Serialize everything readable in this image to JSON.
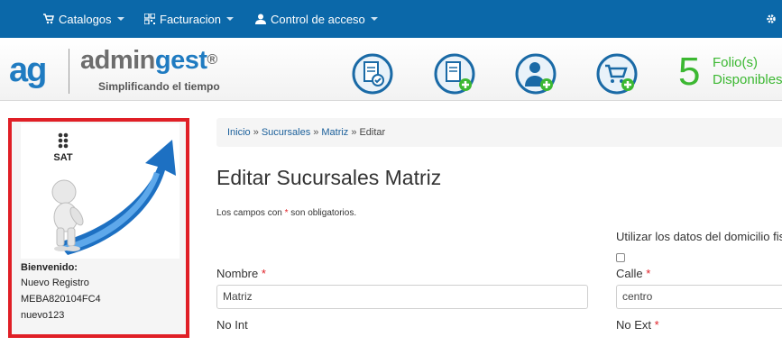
{
  "topnav": {
    "catalogos": "Catalogos",
    "facturacion": "Facturacion",
    "control_acceso": "Control de acceso"
  },
  "brand": {
    "mark": "ag",
    "name_a": "admin",
    "name_b": "gest",
    "registered": "®",
    "tagline": "Simplificando el tiempo"
  },
  "folios": {
    "count": "5",
    "label_line1": "Folio(s)",
    "label_line2": "Disponibles"
  },
  "sidebar": {
    "sat_label": "SAT",
    "welcome": "Bienvenido:",
    "name": "Nuevo Registro",
    "rfc": "MEBA820104FC4",
    "user": "nuevo123"
  },
  "breadcrumb": {
    "inicio": "Inicio",
    "sucursales": "Sucursales",
    "matriz": "Matriz",
    "editar": "Editar",
    "separator": "»"
  },
  "page": {
    "title": "Editar Sucursales Matriz",
    "required_prefix": "Los campos con ",
    "required_star": "*",
    "required_suffix": " son obligatorios."
  },
  "form": {
    "use_fiscal_label": "Utilizar los datos del domicilio fiscal",
    "nombre_label": "Nombre",
    "nombre_value": "Matriz",
    "calle_label": "Calle",
    "calle_value": "centro",
    "no_int_label": "No Int",
    "no_ext_label": "No Ext",
    "star": "*"
  },
  "colors": {
    "nav_blue": "#0b68a9",
    "brand_blue": "#1f7bc1",
    "folio_green": "#3cb832",
    "highlight_red": "#e01f26"
  },
  "icons": [
    "cart-icon",
    "barcode-icon",
    "user-icon",
    "gear-icon",
    "invoice-check-icon",
    "invoice-add-icon",
    "user-add-icon",
    "cart-add-icon"
  ]
}
